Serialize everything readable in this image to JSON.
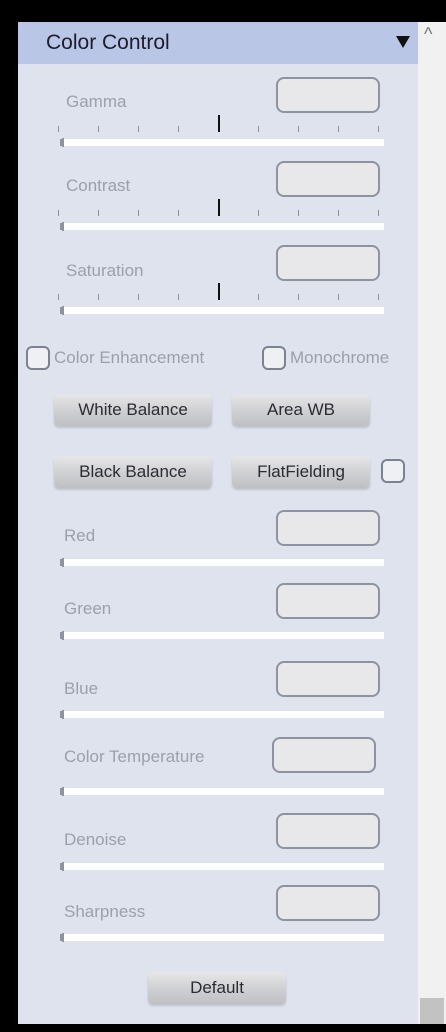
{
  "panel": {
    "title": "Color Control",
    "collapse_icon": "triangle-down-icon",
    "scroll_icon": "scroll-up-arrow-icon"
  },
  "sliders_top": [
    {
      "label": "Gamma",
      "value": ""
    },
    {
      "label": "Contrast",
      "value": ""
    },
    {
      "label": "Saturation",
      "value": ""
    }
  ],
  "options": {
    "color_enhancement_label": "Color Enhancement",
    "color_enhancement_checked": false,
    "monochrome_label": "Monochrome",
    "monochrome_checked": false,
    "flatfielding_checked": false
  },
  "buttons": {
    "white_balance": "White Balance",
    "area_wb": "Area WB",
    "black_balance": "Black Balance",
    "flatfielding": "FlatFielding",
    "default": "Default"
  },
  "sliders_bottom": [
    {
      "label": "Red",
      "value": ""
    },
    {
      "label": "Green",
      "value": ""
    },
    {
      "label": "Blue",
      "value": ""
    },
    {
      "label": "Color Temperature",
      "value": ""
    },
    {
      "label": "Denoise",
      "value": ""
    },
    {
      "label": "Sharpness",
      "value": ""
    }
  ]
}
